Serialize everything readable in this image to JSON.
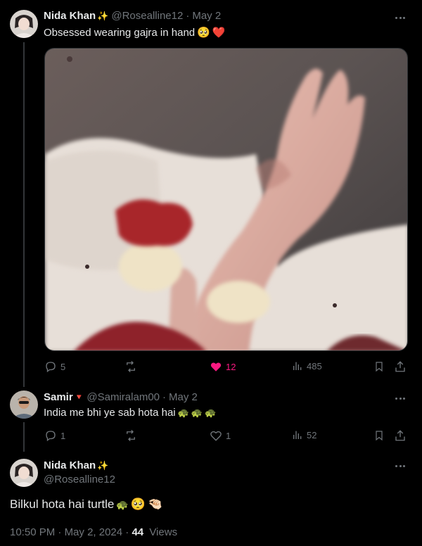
{
  "post1": {
    "author_name": "Nida Khan",
    "author_badge": "✨",
    "handle": "@Rosealline12",
    "date": "May 2",
    "text": "Obsessed wearing gajra in hand",
    "emojis": [
      "🥺",
      "❤️"
    ],
    "stats": {
      "replies": "5",
      "reposts": "",
      "likes": "12",
      "views": "485"
    }
  },
  "post2": {
    "author_name": "Samir",
    "author_badge": "🔻",
    "handle": "@Samiralam00",
    "date": "May 2",
    "text": "India me bhi ye sab hota hai",
    "emojis": [
      "🐢",
      "🐢",
      "🐢"
    ],
    "stats": {
      "replies": "1",
      "reposts": "",
      "likes": "1",
      "views": "52"
    }
  },
  "focus": {
    "author_name": "Nida Khan",
    "author_badge": "✨",
    "handle": "@Rosealline12",
    "text": "Bilkul hota hai turtle",
    "emojis": [
      "🐢",
      "🥺",
      "🤏🏻"
    ],
    "time": "10:50 PM",
    "date": "May 2, 2024",
    "views_count": "44",
    "views_label": "Views"
  },
  "colors": {
    "background": "#000000",
    "text": "#e7e9ea",
    "muted": "#71767b",
    "like": "#f91880"
  },
  "icons": [
    "reply-icon",
    "repost-icon",
    "heart-icon",
    "views-icon",
    "bookmark-icon",
    "share-icon",
    "more-icon"
  ]
}
